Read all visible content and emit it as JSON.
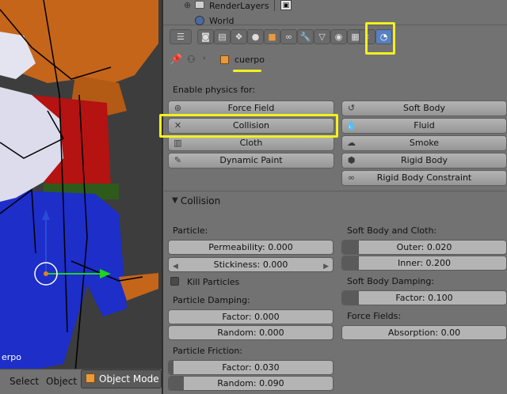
{
  "viewport": {
    "object_label": "erpo",
    "menus": [
      "Select",
      "Object"
    ],
    "mode": "Object Mode"
  },
  "outliner": {
    "row1": "RenderLayers",
    "row2": "World"
  },
  "context": {
    "object_name": "cuerpo"
  },
  "physics": {
    "enable_label": "Enable physics for:",
    "left_buttons": [
      "Force Field",
      "Collision",
      "Cloth",
      "Dynamic Paint"
    ],
    "right_buttons": [
      "Soft Body",
      "Fluid",
      "Smoke",
      "Rigid Body",
      "Rigid Body Constraint"
    ]
  },
  "collision": {
    "title": "Collision",
    "particle_label": "Particle:",
    "permeability": "Permeability: 0.000",
    "stickiness": "Stickiness: 0.000",
    "kill_particles": "Kill Particles",
    "kill_particles_checked": false,
    "damping_label": "Particle Damping:",
    "damping_factor": "Factor: 0.000",
    "damping_random": "Random: 0.000",
    "friction_label": "Particle Friction:",
    "friction_factor": "Factor: 0.030",
    "friction_random": "Random: 0.090",
    "friction_factor_fill": 0.03,
    "friction_random_fill": 0.09,
    "softbody_label": "Soft Body and Cloth:",
    "outer": "Outer: 0.020",
    "inner": "Inner: 0.200",
    "outer_fill": 0.1,
    "inner_fill": 0.1,
    "sb_damping_label": "Soft Body Damping:",
    "sb_damping_factor": "Factor: 0.100",
    "sb_damping_fill": 0.1,
    "forcefields_label": "Force Fields:",
    "absorption": "Absorption: 0.00"
  },
  "colors": {
    "highlight": "#f3f01f",
    "active_tab": "#5680c2"
  }
}
